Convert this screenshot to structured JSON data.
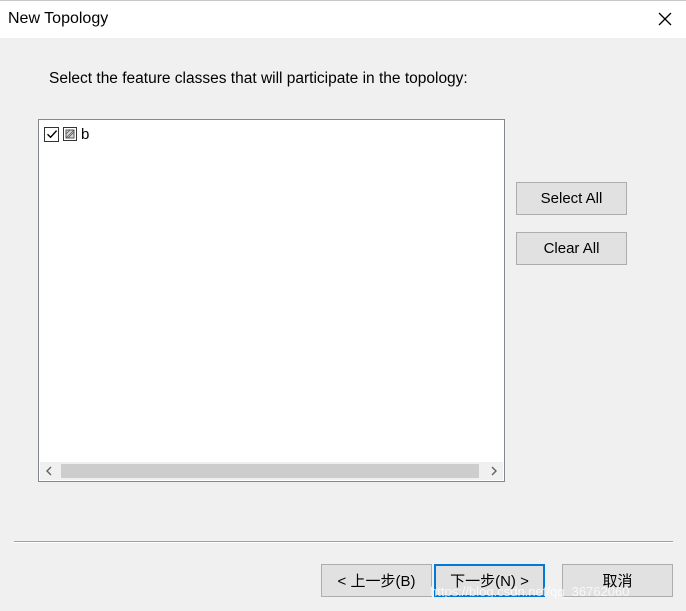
{
  "window": {
    "title": "New Topology",
    "close_icon": "close-icon"
  },
  "instruction": "Select the feature classes that will participate in the topology:",
  "feature_list": {
    "items": [
      {
        "label": "b",
        "checked": true,
        "icon": "polygon-feature-class-icon"
      }
    ],
    "scrollbar": {
      "left_icon": "chevron-left-icon",
      "right_icon": "chevron-right-icon"
    }
  },
  "side_buttons": {
    "select_all": "Select All",
    "clear_all": "Clear All"
  },
  "footer": {
    "back": "< 上一步(B)",
    "next": "下一步(N) >",
    "cancel": "取消"
  },
  "watermark": "https://blog.csdn.net/qq_36762060",
  "colors": {
    "dialog_bg": "#f0f0f0",
    "titlebar_bg": "#ffffff",
    "button_bg": "#e1e1e1",
    "focus_border": "#0078d7"
  }
}
